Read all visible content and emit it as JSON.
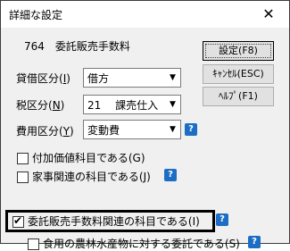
{
  "window": {
    "title": "詳細な設定",
    "close": "✕"
  },
  "header": {
    "account": "764　委託販売手数料"
  },
  "buttons": {
    "ok": "設定(F8)",
    "cancel": "ｷｬﾝｾﾙ(ESC)",
    "help": "ﾍﾙﾌﾟ(F1)"
  },
  "fields": {
    "debit_label": "貸借区分(",
    "debit_key": "I",
    "debit_value": "借方",
    "tax_label": "税区分(",
    "tax_key": "N",
    "tax_value": "21　 課売仕入",
    "cost_label": "費用区分(",
    "cost_key": "Y",
    "cost_value": "変動費"
  },
  "checks": {
    "added_value": "付加価値科目である(G)",
    "household": "家事関連の科目である(J)",
    "commission": "委託販売手数料関連の科目である(I)",
    "food_agri": "食用の農林水産物に対する委託である(S)"
  },
  "help_glyph": "?",
  "icons": {
    "dropdown": "chevron-down-icon",
    "help": "help-icon",
    "check": "check-icon"
  },
  "colors": {
    "help_bg": "#1c6ec4",
    "highlight": "#000000"
  },
  "state": {
    "added_value_checked": false,
    "household_checked": false,
    "commission_checked": true,
    "food_agri_checked": false
  }
}
